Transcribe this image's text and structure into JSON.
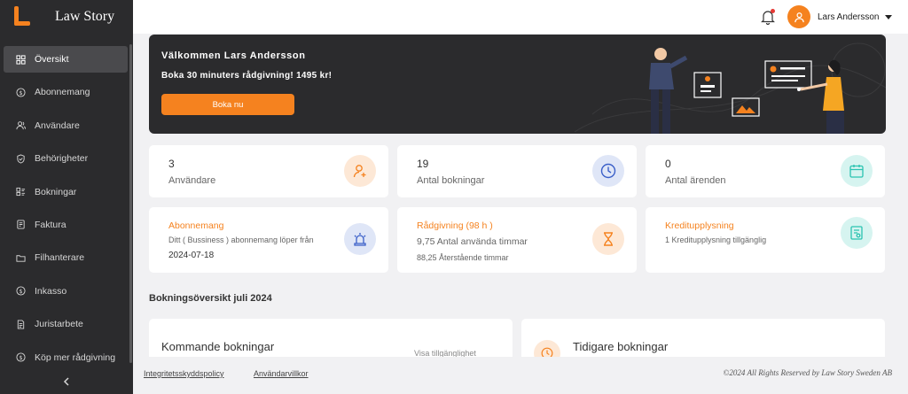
{
  "app": {
    "brand": "Law Story"
  },
  "sidebar": {
    "items": [
      {
        "label": "Översikt",
        "icon": "grid-icon"
      },
      {
        "label": "Abonnemang",
        "icon": "dollar-circle-icon"
      },
      {
        "label": "Användare",
        "icon": "users-icon"
      },
      {
        "label": "Behörigheter",
        "icon": "shield-check-icon"
      },
      {
        "label": "Bokningar",
        "icon": "booking-icon"
      },
      {
        "label": "Faktura",
        "icon": "invoice-icon"
      },
      {
        "label": "Filhanterare",
        "icon": "folder-icon"
      },
      {
        "label": "Inkasso",
        "icon": "dollar-circle-icon"
      },
      {
        "label": "Juristarbete",
        "icon": "document-icon"
      },
      {
        "label": "Köp mer rådgivning",
        "icon": "dollar-circle-icon"
      }
    ],
    "active_index": 0
  },
  "header": {
    "user_name": "Lars Andersson"
  },
  "hero": {
    "title": "Välkommen Lars Andersson",
    "subtitle": "Boka 30 minuters rådgivning! 1495 kr!",
    "button": "Boka nu"
  },
  "stats": [
    {
      "value": "3",
      "label": "Användare",
      "icon": "user-add-icon"
    },
    {
      "value": "19",
      "label": "Antal bokningar",
      "icon": "clock-icon"
    },
    {
      "value": "0",
      "label": "Antal ärenden",
      "icon": "calendar-icon"
    }
  ],
  "info": {
    "subscription": {
      "title": "Abonnemang",
      "line1": "Ditt ( Bussiness ) abonnemang löper från",
      "date": "2024-07-18"
    },
    "advice": {
      "title": "Rådgivning (98 h )",
      "used": "9,75  Antal använda timmar",
      "remaining": "88,25 Återstående timmar"
    },
    "credit": {
      "title": "Kreditupplysning",
      "line1": "1 Kreditupplysning tillgänglig"
    }
  },
  "overview": {
    "title": "Bokningsöversikt juli 2024",
    "upcoming": {
      "title": "Kommande bokningar",
      "link": "Visa tillgänglighet"
    },
    "past": {
      "title": "Tidigare bokningar"
    }
  },
  "footer": {
    "privacy": "Integritetsskyddspolicy",
    "terms": "Användarvillkor",
    "copyright": "©2024 All Rights Reserved by Law Story Sweden AB"
  },
  "colors": {
    "accent": "#f5821f",
    "dark": "#2b2b2d",
    "blue": "#3a5fc8",
    "teal": "#2bc3b1"
  }
}
